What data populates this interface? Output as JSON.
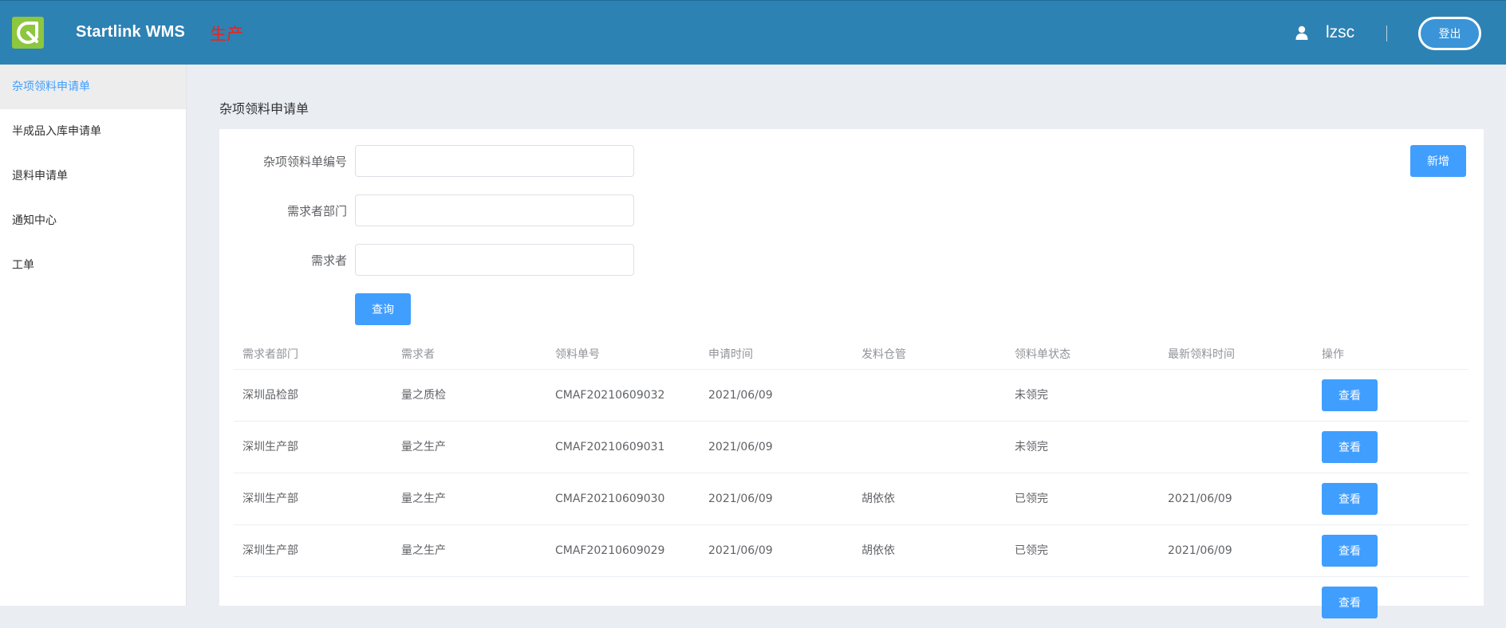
{
  "header": {
    "app_title": "Startlink WMS",
    "module_title": "生产",
    "username": "lzsc",
    "logout_label": "登出",
    "colors": {
      "bar": "#2d82b4",
      "logo": "#8dc63f",
      "module_title": "#e8241b"
    }
  },
  "sidebar": {
    "items": [
      {
        "label": "杂项领料申请单",
        "active": true
      },
      {
        "label": "半成品入库申请单"
      },
      {
        "label": "退料申请单"
      },
      {
        "label": "通知中心"
      },
      {
        "label": "工单"
      }
    ]
  },
  "page": {
    "title": "杂项领料申请单",
    "add_label": "新增",
    "query_label": "查询",
    "form": [
      {
        "label": "杂项领料单编号",
        "value": ""
      },
      {
        "label": "需求者部门",
        "value": ""
      },
      {
        "label": "需求者",
        "value": ""
      }
    ]
  },
  "table": {
    "columns": [
      "需求者部门",
      "需求者",
      "领料单号",
      "申请时间",
      "发料仓管",
      "领料单状态",
      "最新领料时间",
      "操作"
    ],
    "action_label": "查看",
    "rows": [
      [
        "深圳品检部",
        "量之质检",
        "CMAF20210609032",
        "2021/06/09",
        "",
        "未领完",
        ""
      ],
      [
        "深圳生产部",
        "量之生产",
        "CMAF20210609031",
        "2021/06/09",
        "",
        "未领完",
        ""
      ],
      [
        "深圳生产部",
        "量之生产",
        "CMAF20210609030",
        "2021/06/09",
        "胡依依",
        "已领完",
        "2021/06/09"
      ],
      [
        "深圳生产部",
        "量之生产",
        "CMAF20210609029",
        "2021/06/09",
        "胡依依",
        "已领完",
        "2021/06/09"
      ]
    ]
  }
}
